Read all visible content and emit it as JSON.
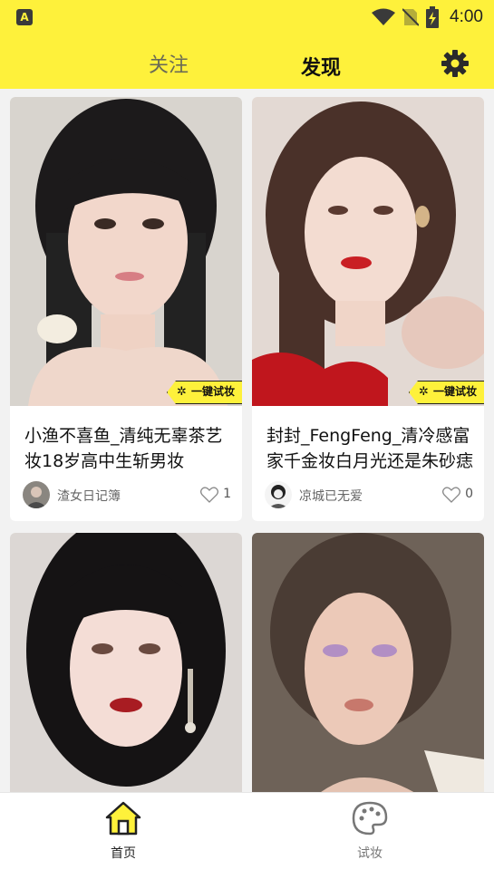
{
  "status_bar": {
    "time": "4:00",
    "app_icon": "A"
  },
  "header": {
    "tabs": [
      {
        "label": "关注",
        "active": false
      },
      {
        "label": "发现",
        "active": true
      }
    ],
    "settings_icon": "gear-icon"
  },
  "feed": {
    "cards": [
      {
        "title": "小渔不喜鱼_清纯无辜茶艺妆18岁高中生斩男妆",
        "author": "渣女日记簿",
        "likes": "1",
        "badge": "一键试妆"
      },
      {
        "title": "封封_FengFeng_清冷感富家千金妆白月光还是朱砂痣",
        "author": "凉城已无爱",
        "likes": "0",
        "badge": "一键试妆"
      },
      {
        "title": "",
        "author": "",
        "likes": ""
      },
      {
        "title": "",
        "author": "",
        "likes": ""
      }
    ]
  },
  "bottom_nav": {
    "items": [
      {
        "label": "首页",
        "icon": "home-icon",
        "active": true
      },
      {
        "label": "试妆",
        "icon": "palette-icon",
        "active": false
      }
    ]
  },
  "colors": {
    "accent": "#fef13b",
    "text": "#111111",
    "muted": "#666666"
  }
}
